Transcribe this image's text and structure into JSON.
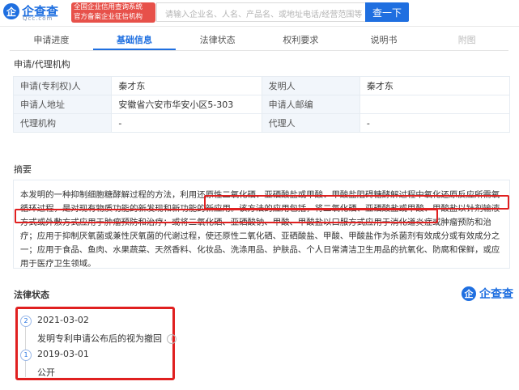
{
  "brand": {
    "logo_mark": "企",
    "name": "企查查",
    "sub": "Qcc.com",
    "tagline_line1": "全国企业信用查询系统",
    "tagline_line2": "官方备案企业征信机构"
  },
  "search": {
    "placeholder": "请输入企业名、人名、产品名、或地址电话/经营范围等",
    "button_label": "查一下"
  },
  "tabs": [
    {
      "label": "申请进度"
    },
    {
      "label": "基础信息"
    },
    {
      "label": "法律状态"
    },
    {
      "label": "权利要求"
    },
    {
      "label": "说明书"
    },
    {
      "label": "附图"
    }
  ],
  "applicant_section": {
    "title": "申请/代理机构",
    "rows": [
      {
        "label1": "申请(专利权)人",
        "value1": "秦才东",
        "label2": "发明人",
        "value2": "秦才东"
      },
      {
        "label1": "申请人地址",
        "value1": "安徽省六安市华安小区5-303",
        "label2": "申请人邮编",
        "value2": ""
      },
      {
        "label1": "代理机构",
        "value1": "-",
        "label2": "代理人",
        "value2": "-"
      }
    ]
  },
  "abstract": {
    "title": "摘要",
    "text": "本发明的一种抑制细胞糖酵解过程的方法，利用还原性二氧化硒、亚硒酸盐或甲酸、甲酸盐阻碍糖酵解过程中氧化还原反应所需氧循环过程，是对现有物质功能的新发现和新功能的新应用。该方法的应用包括，将二氧化硒、亚硒酸盐或甲酸、甲酸盐以针剂输液方式或外敷方式应用于肿瘤预防和治疗；或将二氧化硒、亚硒酸钠、甲酸、甲酸盐以口服方式应用于消化道炎症或肿瘤预防和治疗；应用于抑制厌氧菌或兼性厌氧菌的代谢过程，使还原性二氧化硒、亚硒酸盐、甲酸、甲酸盐作为杀菌剂有效成分或有效成分之一；应用于食品、鱼肉、水果蔬菜、天然香料、化妆品、洗涤用品、护肤品、个人日常清洁卫生用品的抗氧化、防腐和保鲜，或应用于医疗卫生领域。"
  },
  "legal_status": {
    "title": "法律状态",
    "brand_name": "企查查",
    "events": [
      {
        "index": "2",
        "date": "2021-03-02",
        "desc": "发明专利申请公布后的视为撤回"
      },
      {
        "index": "1",
        "date": "2019-03-01",
        "desc": "公开"
      }
    ]
  },
  "colors": {
    "accent": "#1f6fe0",
    "highlight": "#e02020"
  }
}
